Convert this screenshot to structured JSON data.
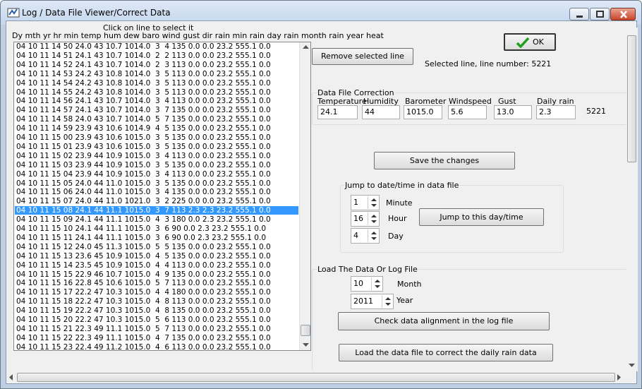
{
  "window": {
    "title": "Log / Data File Viewer/Correct Data"
  },
  "list": {
    "hint": "Click on line to select it",
    "header": "Dy mth yr hr min temp hum dew baro wind gust dir rain min rain day rain month rain year heat",
    "rows": [
      "04 10 11 14 50 24.0 43 10.7 1014.0  3  4 135 0.0 0.0 23.2 555.1 0.0",
      "04 10 11 14 51 24.1 43 10.7 1014.0  2  2 113 0.0 0.0 23.2 555.1 0.0",
      "04 10 11 14 52 24.1 43 10.7 1014.0  2  3 113 0.0 0.0 23.2 555.1 0.0",
      "04 10 11 14 53 24.2 43 10.8 1014.0  3  5 113 0.0 0.0 23.2 555.1 0.0",
      "04 10 11 14 54 24.2 43 10.8 1014.0  3  5 113 0.0 0.0 23.2 555.1 0.0",
      "04 10 11 14 55 24.2 43 10.8 1014.0  3  5 113 0.0 0.0 23.2 555.1 0.0",
      "04 10 11 14 56 24.1 43 10.7 1014.0  3  4 113 0.0 0.0 23.2 555.1 0.0",
      "04 10 11 14 57 24.1 43 10.7 1014.0  3  7 135 0.0 0.0 23.2 555.1 0.0",
      "04 10 11 14 58 24.0 43 10.7 1014.0  5  7 135 0.0 0.0 23.2 555.1 0.0",
      "04 10 11 14 59 23.9 43 10.6 1014.9  4  5 135 0.0 0.0 23.2 555.1 0.0",
      "04 10 11 15 00 23.9 43 10.6 1015.0  3  5 135 0.0 0.0 23.2 555.1 0.0",
      "04 10 11 15 01 23.9 43 10.6 1015.0  3  5 135 0.0 0.0 23.2 555.1 0.0",
      "04 10 11 15 02 23.9 44 10.9 1015.0  3  4 113 0.0 0.0 23.2 555.1 0.0",
      "04 10 11 15 03 23.9 44 10.9 1015.0  3  5 135 0.0 0.0 23.2 555.1 0.0",
      "04 10 11 15 04 23.9 44 10.9 1015.0  3  4 113 0.0 0.0 23.2 555.1 0.0",
      "04 10 11 15 05 24.0 44 11.0 1015.0  3  5 135 0.0 0.0 23.2 555.1 0.0",
      "04 10 11 15 06 24.0 44 11.0 1015.0  3  4 135 0.0 0.0 23.2 555.1 0.0",
      "04 10 11 15 07 24.0 44 11.0 1021.0  3  2 225 0.0 0.0 23.2 555.1 0.0",
      "04 10 11 15 08 24.1 44 11.1 1015.0  3  7 113 2.3 2.3 23.2 555.1 0.0",
      "04 10 11 15 09 24.1 44 11.1 1015.0  4  3 180 0.0 2.3 23.2 555.1 0.0",
      "04 10 11 15 10 24.1 44 11.1 1015.0  3  6 90 0.0 2.3 23.2 555.1 0.0",
      "04 10 11 15 11 24.1 44 11.1 1015.0  3  6 90 0.0 2.3 23.2 555.1 0.0",
      "04 10 11 15 12 24.0 45 11.3 1015.0  5  5 135 0.0 0.0 23.2 555.1 0.0",
      "04 10 11 15 13 23.6 45 10.9 1015.0  4  5 135 0.0 0.0 23.2 555.1 0.0",
      "04 10 11 15 14 23.5 45 10.9 1015.0  4  4 113 0.0 0.0 23.2 555.1 0.0",
      "04 10 11 15 15 22.9 46 10.7 1015.0  4  9 135 0.0 0.0 23.2 555.1 0.0",
      "04 10 11 15 16 22.8 45 10.6 1015.0  5  7 113 0.0 0.0 23.2 555.1 0.0",
      "04 10 11 15 17 22.2 47 10.3 1015.0  4  4 180 0.0 0.0 23.2 555.1 0.0",
      "04 10 11 15 18 22.2 47 10.3 1015.0  4  8 113 0.0 0.0 23.2 555.1 0.0",
      "04 10 11 15 19 22.2 47 10.3 1015.0  4  8 135 0.0 0.0 23.2 555.1 0.0",
      "04 10 11 15 20 22.2 47 10.3 1015.0  5  6 113 0.0 0.0 23.2 555.1 0.0",
      "04 10 11 15 21 22.3 49 11.1 1015.0  5  7 113 0.0 0.0 23.2 555.1 0.0",
      "04 10 11 15 22 22.3 49 11.1 1015.0  4  7 135 0.0 0.0 23.2 555.1 0.0",
      "04 10 11 15 23 22.4 49 11.2 1015.0  4  6 113 0.0 0.0 23.2 555.1 0.0"
    ],
    "selected_index": 18
  },
  "buttons": {
    "ok": "OK",
    "remove": "Remove selected line",
    "save": "Save the changes",
    "jump": "Jump to this day/time",
    "check": "Check data alignment in the log file",
    "load": "Load the data file to correct the daily rain data"
  },
  "selected_info": "Selected line, line number: 5221",
  "correction": {
    "title": "Data File Correction",
    "fields": [
      {
        "label": "Temperature",
        "value": "24.1"
      },
      {
        "label": "Humidity",
        "value": "44"
      },
      {
        "label": "Barometer",
        "value": "1015.0"
      },
      {
        "label": "Windspeed",
        "value": "5.6"
      },
      {
        "label": "Gust",
        "value": "13.0"
      },
      {
        "label": "Daily rain",
        "value": "2.3"
      }
    ],
    "line_number": "5221"
  },
  "jump": {
    "title": "Jump to date/time in data file",
    "minute_label": "Minute",
    "minute": "1",
    "hour_label": "Hour",
    "hour": "16",
    "day_label": "Day",
    "day": "4"
  },
  "load": {
    "title": "Load The Data Or Log File",
    "month_label": "Month",
    "month": "10",
    "year_label": "Year",
    "year": "2011"
  },
  "colors": {
    "selection": "#3399ff",
    "ok_check": "#1e9e1e",
    "close_button": "#c9452c"
  }
}
